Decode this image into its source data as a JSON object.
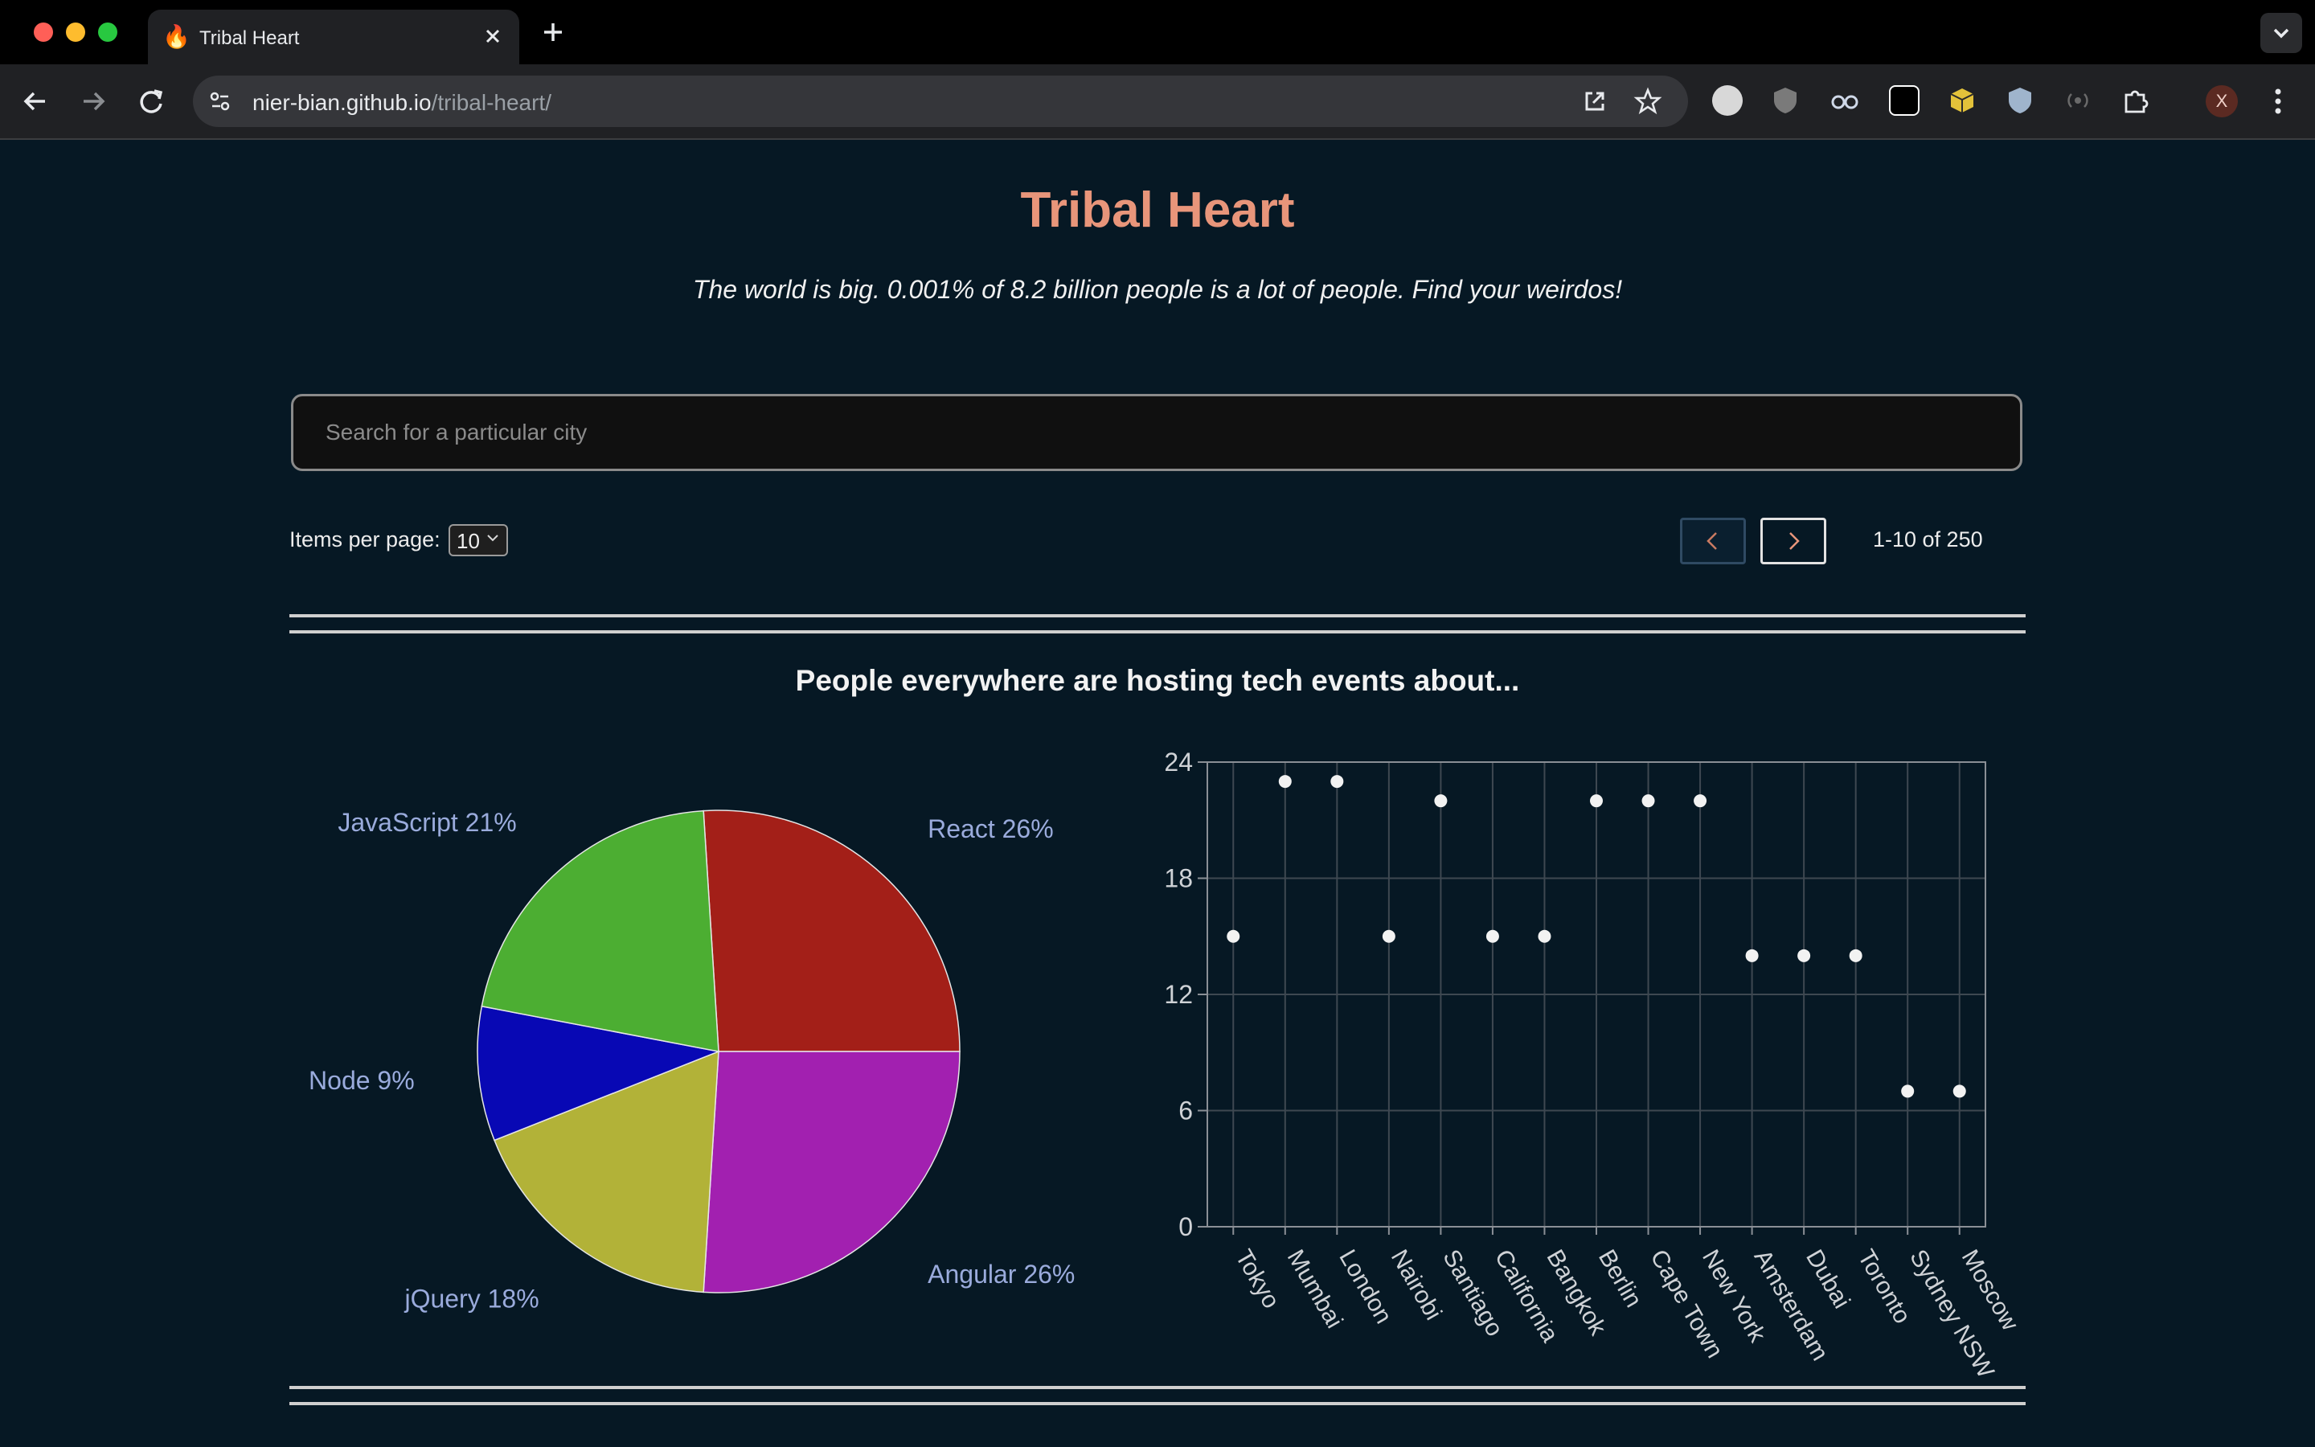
{
  "browser": {
    "tab_title": "Tribal Heart",
    "url_host": "nier-bian.github.io",
    "url_path": "/tribal-heart/",
    "profile_initial": "X"
  },
  "icons": {
    "favicon": "fire-icon",
    "close": "close-icon",
    "new_tab": "plus-icon",
    "back": "arrow-left-icon",
    "forward": "arrow-right-icon",
    "reload": "reload-icon",
    "site_info": "tune-icon",
    "open_in_app": "open-external-icon",
    "bookmark": "star-icon",
    "extensions": "puzzle-icon",
    "menu": "kebab-menu-icon"
  },
  "page": {
    "title": "Tribal Heart",
    "tagline": "The world is big. 0.001% of 8.2 billion people is a lot of people. Find your weirdos!",
    "search_placeholder": "Search for a particular city",
    "items_per_page_label": "Items per page:",
    "items_per_page_value": "10",
    "pagination_info": "1-10 of 250",
    "chart_heading": "People everywhere are hosting tech events about..."
  },
  "colors": {
    "background": "#061824",
    "title": "#e8957a",
    "pie_labels": "#9aabdc"
  },
  "chart_data": [
    {
      "type": "pie",
      "slices": [
        {
          "label": "React 26%",
          "value": 26,
          "color": "#a31f18"
        },
        {
          "label": "Angular 26%",
          "value": 26,
          "color": "#a220b0"
        },
        {
          "label": "jQuery 18%",
          "value": 18,
          "color": "#b2b238"
        },
        {
          "label": "Node 9%",
          "value": 9,
          "color": "#0808b4"
        },
        {
          "label": "JavaScript 21%",
          "value": 21,
          "color": "#4cae32"
        }
      ]
    },
    {
      "type": "scatter",
      "categories": [
        "Tokyo",
        "Mumbai",
        "London",
        "Nairobi",
        "Santiago",
        "California",
        "Bangkok",
        "Berlin",
        "Cape Town",
        "New York",
        "Amsterdam",
        "Dubai",
        "Toronto",
        "Sydney NSW",
        "Moscow"
      ],
      "values": [
        15,
        23,
        23,
        15,
        22,
        15,
        15,
        22,
        22,
        22,
        14,
        14,
        14,
        7,
        7
      ],
      "y_ticks": [
        "0",
        "6",
        "12",
        "18",
        "24"
      ],
      "ylim": [
        0,
        24
      ],
      "grid": true
    }
  ]
}
